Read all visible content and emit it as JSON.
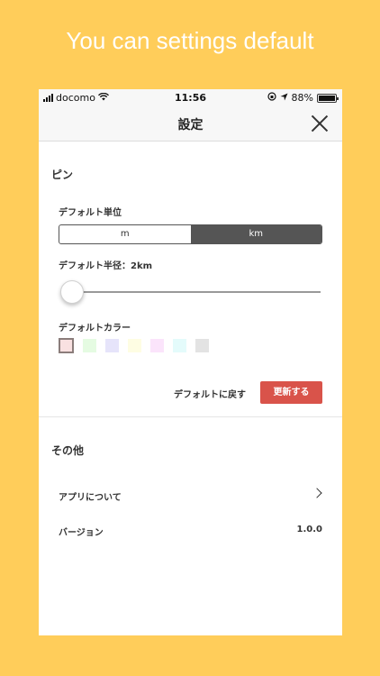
{
  "promo": {
    "headline": "You can settings default"
  },
  "status_bar": {
    "carrier": "docomo",
    "time": "11:56",
    "battery": "88%",
    "battery_level": 0.88
  },
  "nav": {
    "title": "設定",
    "close_icon": "close-icon"
  },
  "pin_section": {
    "title": "ピン",
    "unit_label": "デフォルト単位",
    "units": [
      "m",
      "km"
    ],
    "selected_unit": "km",
    "radius_label": "デフォルト半径：2km",
    "radius_slider_level": 0.0,
    "color_label": "デフォルトカラー",
    "colors": [
      "#f9e1e1",
      "#e5fbe2",
      "#e6e4fa",
      "#fefde3",
      "#fbe4fb",
      "#e4fbfb",
      "#e3e3e3"
    ],
    "selected_color_index": 0,
    "reset_label": "デフォルトに戻す",
    "update_label": "更新する",
    "accent": "#d9534a"
  },
  "other_section": {
    "title": "その他",
    "about_label": "アプリについて",
    "version_label": "バージョン",
    "version_value": "1.0.0"
  }
}
